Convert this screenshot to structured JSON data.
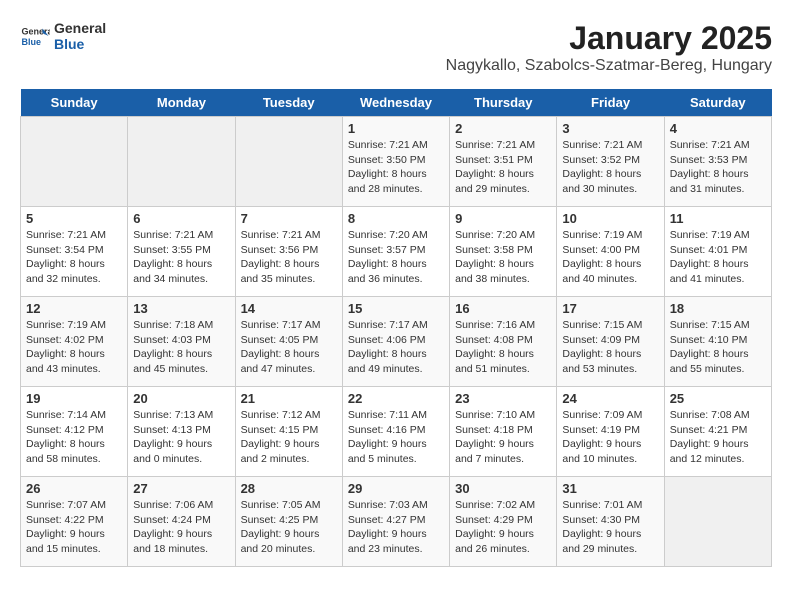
{
  "logo": {
    "general": "General",
    "blue": "Blue"
  },
  "title": "January 2025",
  "subtitle": "Nagykallo, Szabolcs-Szatmar-Bereg, Hungary",
  "weekdays": [
    "Sunday",
    "Monday",
    "Tuesday",
    "Wednesday",
    "Thursday",
    "Friday",
    "Saturday"
  ],
  "weeks": [
    [
      {
        "day": "",
        "info": ""
      },
      {
        "day": "",
        "info": ""
      },
      {
        "day": "",
        "info": ""
      },
      {
        "day": "1",
        "info": "Sunrise: 7:21 AM\nSunset: 3:50 PM\nDaylight: 8 hours and 28 minutes."
      },
      {
        "day": "2",
        "info": "Sunrise: 7:21 AM\nSunset: 3:51 PM\nDaylight: 8 hours and 29 minutes."
      },
      {
        "day": "3",
        "info": "Sunrise: 7:21 AM\nSunset: 3:52 PM\nDaylight: 8 hours and 30 minutes."
      },
      {
        "day": "4",
        "info": "Sunrise: 7:21 AM\nSunset: 3:53 PM\nDaylight: 8 hours and 31 minutes."
      }
    ],
    [
      {
        "day": "5",
        "info": "Sunrise: 7:21 AM\nSunset: 3:54 PM\nDaylight: 8 hours and 32 minutes."
      },
      {
        "day": "6",
        "info": "Sunrise: 7:21 AM\nSunset: 3:55 PM\nDaylight: 8 hours and 34 minutes."
      },
      {
        "day": "7",
        "info": "Sunrise: 7:21 AM\nSunset: 3:56 PM\nDaylight: 8 hours and 35 minutes."
      },
      {
        "day": "8",
        "info": "Sunrise: 7:20 AM\nSunset: 3:57 PM\nDaylight: 8 hours and 36 minutes."
      },
      {
        "day": "9",
        "info": "Sunrise: 7:20 AM\nSunset: 3:58 PM\nDaylight: 8 hours and 38 minutes."
      },
      {
        "day": "10",
        "info": "Sunrise: 7:19 AM\nSunset: 4:00 PM\nDaylight: 8 hours and 40 minutes."
      },
      {
        "day": "11",
        "info": "Sunrise: 7:19 AM\nSunset: 4:01 PM\nDaylight: 8 hours and 41 minutes."
      }
    ],
    [
      {
        "day": "12",
        "info": "Sunrise: 7:19 AM\nSunset: 4:02 PM\nDaylight: 8 hours and 43 minutes."
      },
      {
        "day": "13",
        "info": "Sunrise: 7:18 AM\nSunset: 4:03 PM\nDaylight: 8 hours and 45 minutes."
      },
      {
        "day": "14",
        "info": "Sunrise: 7:17 AM\nSunset: 4:05 PM\nDaylight: 8 hours and 47 minutes."
      },
      {
        "day": "15",
        "info": "Sunrise: 7:17 AM\nSunset: 4:06 PM\nDaylight: 8 hours and 49 minutes."
      },
      {
        "day": "16",
        "info": "Sunrise: 7:16 AM\nSunset: 4:08 PM\nDaylight: 8 hours and 51 minutes."
      },
      {
        "day": "17",
        "info": "Sunrise: 7:15 AM\nSunset: 4:09 PM\nDaylight: 8 hours and 53 minutes."
      },
      {
        "day": "18",
        "info": "Sunrise: 7:15 AM\nSunset: 4:10 PM\nDaylight: 8 hours and 55 minutes."
      }
    ],
    [
      {
        "day": "19",
        "info": "Sunrise: 7:14 AM\nSunset: 4:12 PM\nDaylight: 8 hours and 58 minutes."
      },
      {
        "day": "20",
        "info": "Sunrise: 7:13 AM\nSunset: 4:13 PM\nDaylight: 9 hours and 0 minutes."
      },
      {
        "day": "21",
        "info": "Sunrise: 7:12 AM\nSunset: 4:15 PM\nDaylight: 9 hours and 2 minutes."
      },
      {
        "day": "22",
        "info": "Sunrise: 7:11 AM\nSunset: 4:16 PM\nDaylight: 9 hours and 5 minutes."
      },
      {
        "day": "23",
        "info": "Sunrise: 7:10 AM\nSunset: 4:18 PM\nDaylight: 9 hours and 7 minutes."
      },
      {
        "day": "24",
        "info": "Sunrise: 7:09 AM\nSunset: 4:19 PM\nDaylight: 9 hours and 10 minutes."
      },
      {
        "day": "25",
        "info": "Sunrise: 7:08 AM\nSunset: 4:21 PM\nDaylight: 9 hours and 12 minutes."
      }
    ],
    [
      {
        "day": "26",
        "info": "Sunrise: 7:07 AM\nSunset: 4:22 PM\nDaylight: 9 hours and 15 minutes."
      },
      {
        "day": "27",
        "info": "Sunrise: 7:06 AM\nSunset: 4:24 PM\nDaylight: 9 hours and 18 minutes."
      },
      {
        "day": "28",
        "info": "Sunrise: 7:05 AM\nSunset: 4:25 PM\nDaylight: 9 hours and 20 minutes."
      },
      {
        "day": "29",
        "info": "Sunrise: 7:03 AM\nSunset: 4:27 PM\nDaylight: 9 hours and 23 minutes."
      },
      {
        "day": "30",
        "info": "Sunrise: 7:02 AM\nSunset: 4:29 PM\nDaylight: 9 hours and 26 minutes."
      },
      {
        "day": "31",
        "info": "Sunrise: 7:01 AM\nSunset: 4:30 PM\nDaylight: 9 hours and 29 minutes."
      },
      {
        "day": "",
        "info": ""
      }
    ]
  ]
}
